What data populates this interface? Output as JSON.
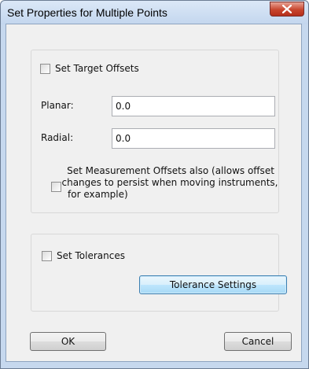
{
  "window": {
    "title": "Set Properties for Multiple Points"
  },
  "target_offsets": {
    "checkbox_label": "Set Target Offsets",
    "planar_label": "Planar:",
    "planar_value": "0.0",
    "radial_label": "Radial:",
    "radial_value": "0.0",
    "measurement_label_line1": "Set Measurement Offsets also (allows offset",
    "measurement_label_line2": "changes to persist when moving instruments,",
    "measurement_label_line3": "for example)"
  },
  "tolerances": {
    "checkbox_label": "Set Tolerances",
    "settings_button": "Tolerance Settings"
  },
  "buttons": {
    "ok": "OK",
    "cancel": "Cancel"
  }
}
